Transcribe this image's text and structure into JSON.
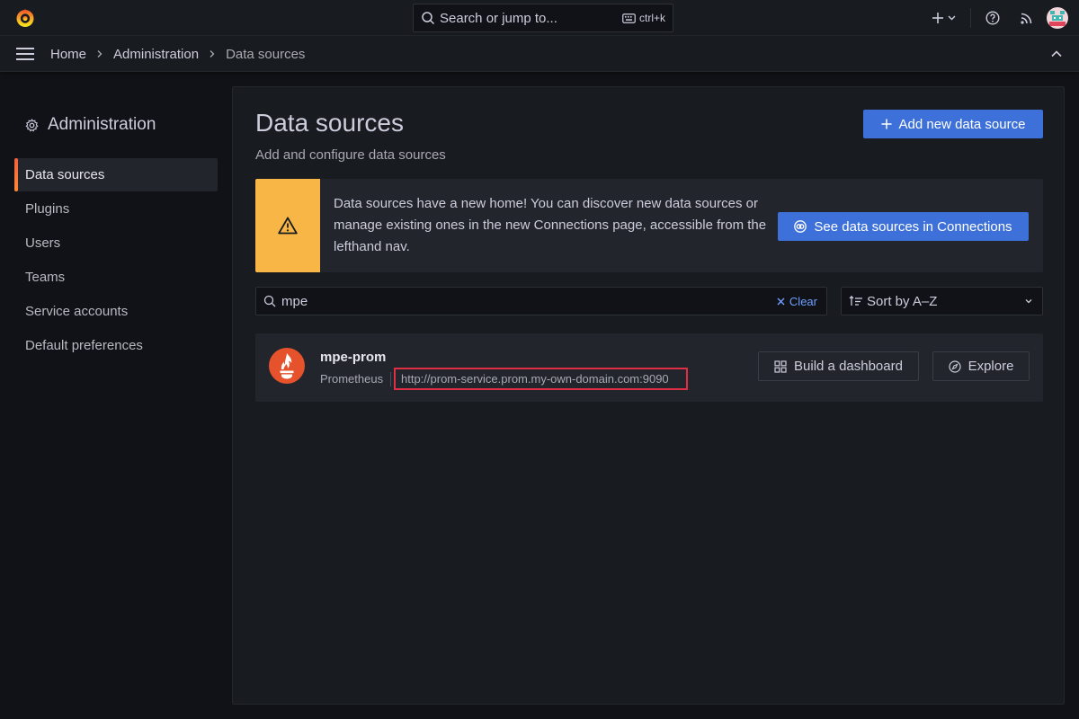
{
  "topbar": {
    "search_placeholder": "Search or jump to...",
    "search_shortcut": "ctrl+k",
    "icons": [
      "grafana-logo-icon",
      "search-icon",
      "keyboard-icon",
      "plus-icon",
      "chevron-down-icon",
      "help-icon",
      "news-rss-icon",
      "user-avatar"
    ]
  },
  "breadcrumb": {
    "items": [
      "Home",
      "Administration",
      "Data sources"
    ]
  },
  "sidebar": {
    "title": "Administration",
    "items": [
      {
        "label": "Data sources",
        "active": true
      },
      {
        "label": "Plugins",
        "active": false
      },
      {
        "label": "Users",
        "active": false
      },
      {
        "label": "Teams",
        "active": false
      },
      {
        "label": "Service accounts",
        "active": false
      },
      {
        "label": "Default preferences",
        "active": false
      }
    ]
  },
  "main": {
    "title": "Data sources",
    "subtitle": "Add and configure data sources",
    "add_button_label": "Add new data source",
    "alert": {
      "text": "Data sources have a new home! You can discover new data sources or manage existing ones in the new Connections page, accessible from the lefthand nav.",
      "button_label": "See data sources in Connections"
    },
    "filter": {
      "value": "mpe",
      "clear_label": "Clear"
    },
    "sort": {
      "selected": "Sort by A–Z"
    },
    "datasources": [
      {
        "name": "mpe-prom",
        "type": "Prometheus",
        "url": "http://prom-service.prom.my-own-domain.com:9090",
        "build_label": "Build a dashboard",
        "explore_label": "Explore"
      }
    ]
  },
  "colors": {
    "accent_blue": "#3d71d9",
    "warning_yellow": "#f7b645",
    "active_bar": "#f55f3e",
    "highlight_red": "#e02f44",
    "prometheus_orange": "#e6522c"
  }
}
